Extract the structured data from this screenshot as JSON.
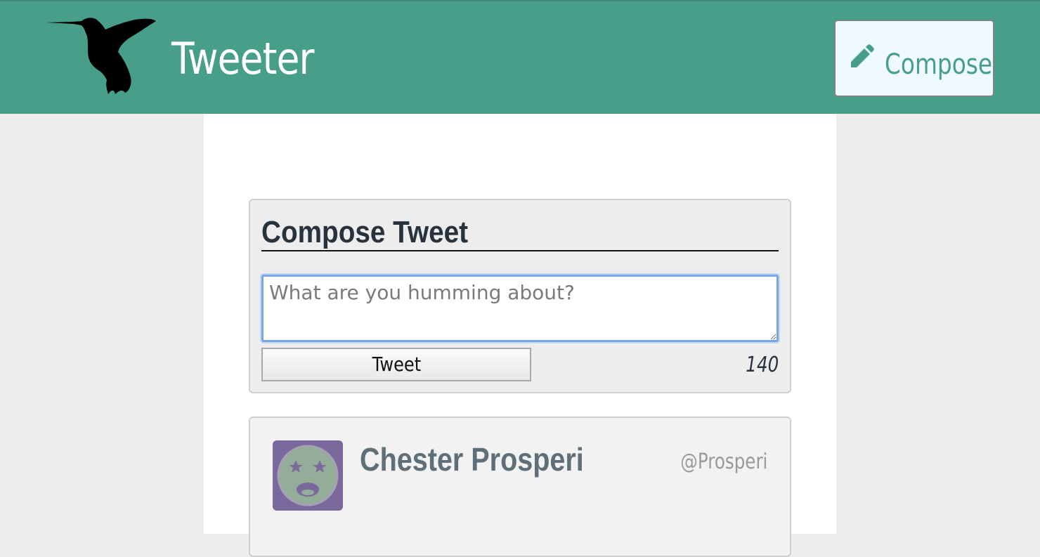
{
  "header": {
    "brand": "Tweeter",
    "logo_icon": "hummingbird-icon",
    "compose_label": "Compose",
    "compose_icon": "pencil-icon",
    "bg_color": "#479e89"
  },
  "compose": {
    "title": "Compose Tweet",
    "placeholder": "What are you humming about?",
    "submit_label": "Tweet",
    "counter": "140"
  },
  "tweets": [
    {
      "name": "Chester Prosperi",
      "handle": "@Prosperi",
      "avatar_icon": "dizzy-face-avatar-icon",
      "avatar_color": "#7a6a9c"
    }
  ]
}
